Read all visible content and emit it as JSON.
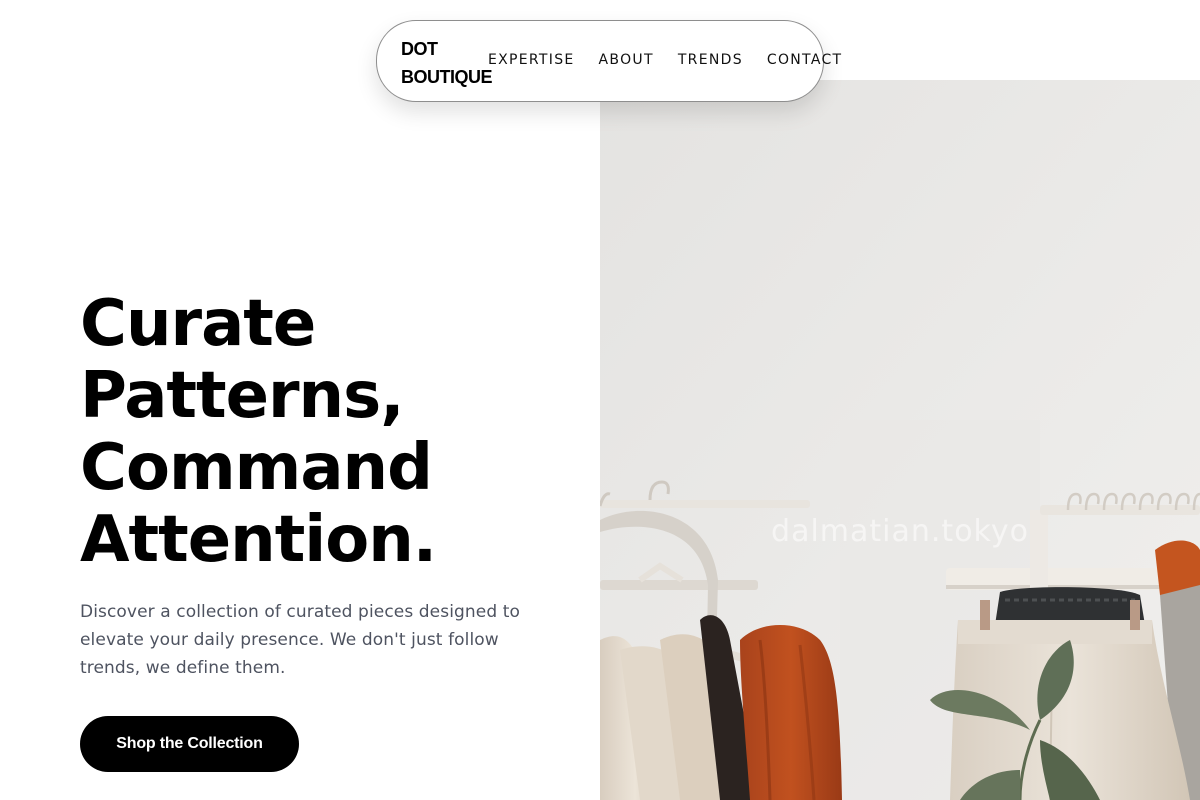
{
  "brand": {
    "line1": "DOT",
    "line2": "BOUTIQUE"
  },
  "nav": {
    "items": [
      "EXPERTISE",
      "ABOUT",
      "TRENDS",
      "CONTACT"
    ]
  },
  "hero": {
    "headline": [
      "Curate",
      "Patterns,",
      "Command",
      "Attention."
    ],
    "lead": "Discover a collection of curated pieces designed to elevate your daily presence. We don't just follow trends, we define them.",
    "cta": "Shop the Collection",
    "image_watermark": "dalmatian.tokyo"
  },
  "colors": {
    "text": "#000000",
    "lead": "#4e5360",
    "cta_bg": "#000000",
    "cta_text": "#ffffff",
    "nav_border": "#8e8e8e"
  }
}
